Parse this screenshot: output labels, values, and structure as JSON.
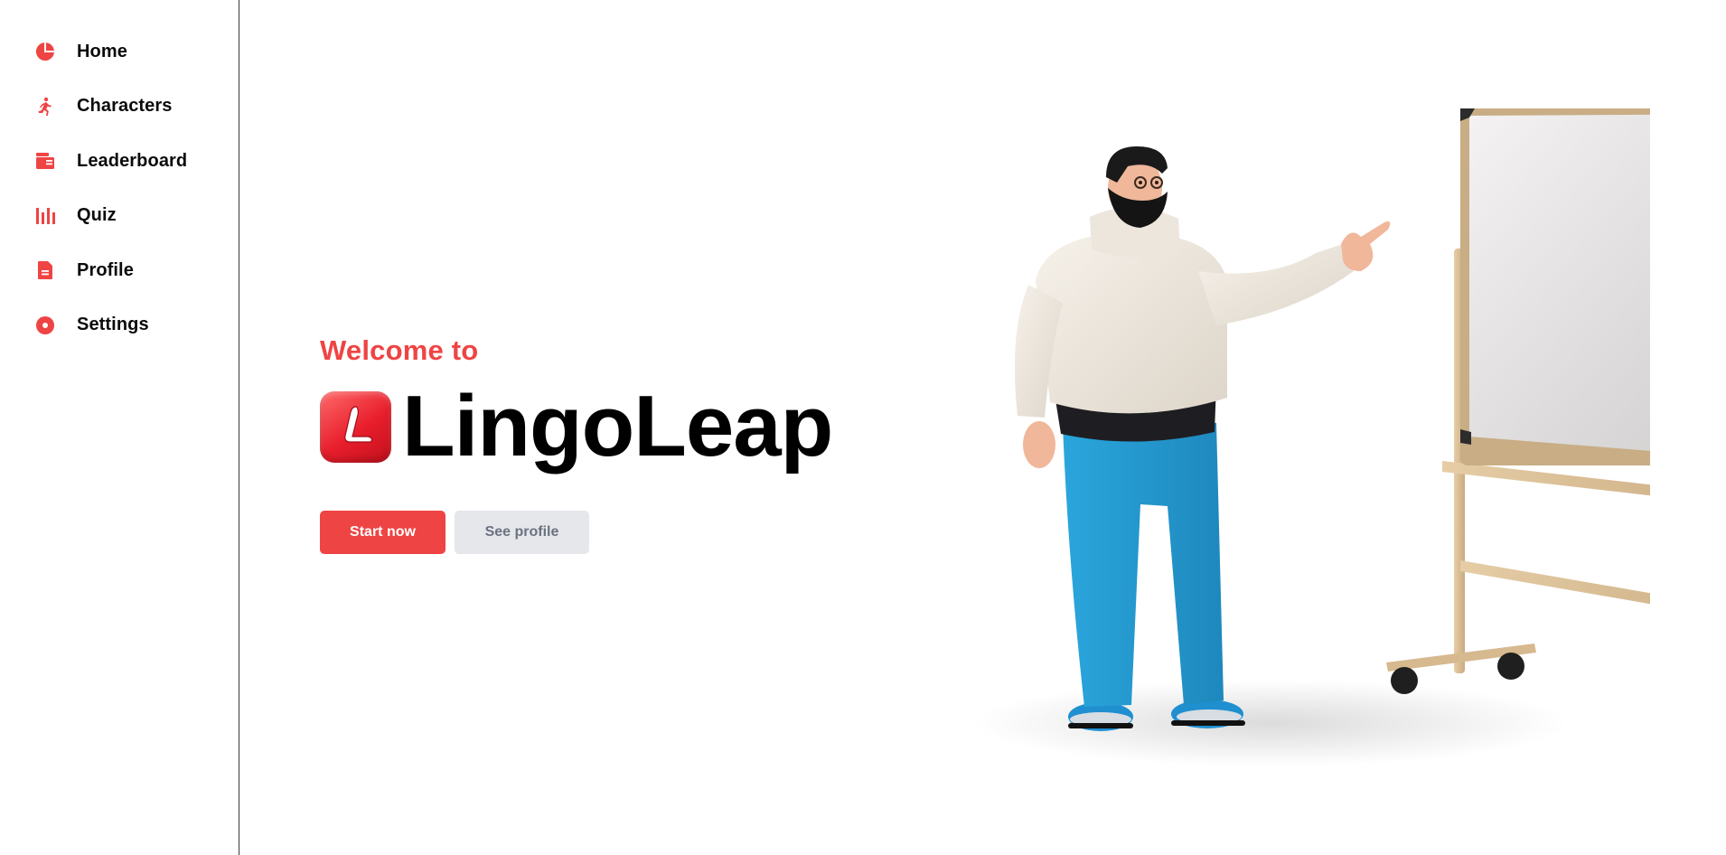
{
  "sidebar": {
    "items": [
      {
        "label": "Home",
        "icon": "pie-chart-icon"
      },
      {
        "label": "Characters",
        "icon": "running-figure-icon"
      },
      {
        "label": "Leaderboard",
        "icon": "list-card-icon"
      },
      {
        "label": "Quiz",
        "icon": "bars-icon"
      },
      {
        "label": "Profile",
        "icon": "document-icon"
      },
      {
        "label": "Settings",
        "icon": "record-dot-icon"
      }
    ]
  },
  "hero": {
    "welcome": "Welcome to",
    "brand_name": "LingoLeap",
    "logo_letter": "L",
    "start_button": "Start now",
    "profile_button": "See profile"
  },
  "colors": {
    "accent": "#ef4444",
    "secondary_button_bg": "#e5e7eb",
    "secondary_button_text": "#6b7280"
  },
  "illustration": {
    "subject": "3d-man-pointing-at-whiteboard"
  }
}
